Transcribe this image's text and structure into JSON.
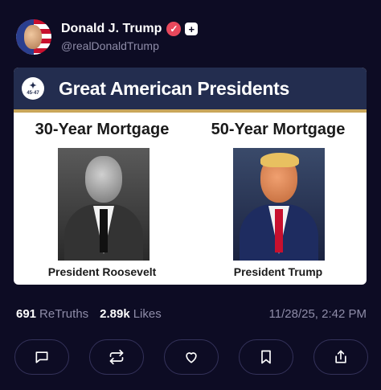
{
  "author": {
    "name": "Donald J. Trump",
    "handle": "@realDonaldTrump",
    "verified_glyph": "✓",
    "plus_glyph": "+"
  },
  "card": {
    "banner_title": "Great American Presidents",
    "seal_text": "45·47",
    "left": {
      "heading": "30-Year Mortgage",
      "caption": "President Roosevelt"
    },
    "right": {
      "heading": "50-Year Mortgage",
      "caption": "President Trump"
    }
  },
  "stats": {
    "retruths_count": "691",
    "retruths_label": "ReTruths",
    "likes_count": "2.89k",
    "likes_label": "Likes",
    "timestamp": "11/28/25, 2:42 PM"
  },
  "actions": [
    {
      "icon": "reply-icon"
    },
    {
      "icon": "retruth-icon"
    },
    {
      "icon": "like-icon"
    },
    {
      "icon": "bookmark-icon"
    },
    {
      "icon": "share-icon"
    }
  ],
  "colors": {
    "background": "#0d0c24",
    "banner": "#232d4f",
    "banner_accent": "#c9a65a",
    "verified": "#e8485c",
    "muted_text": "#8e8ca8"
  }
}
